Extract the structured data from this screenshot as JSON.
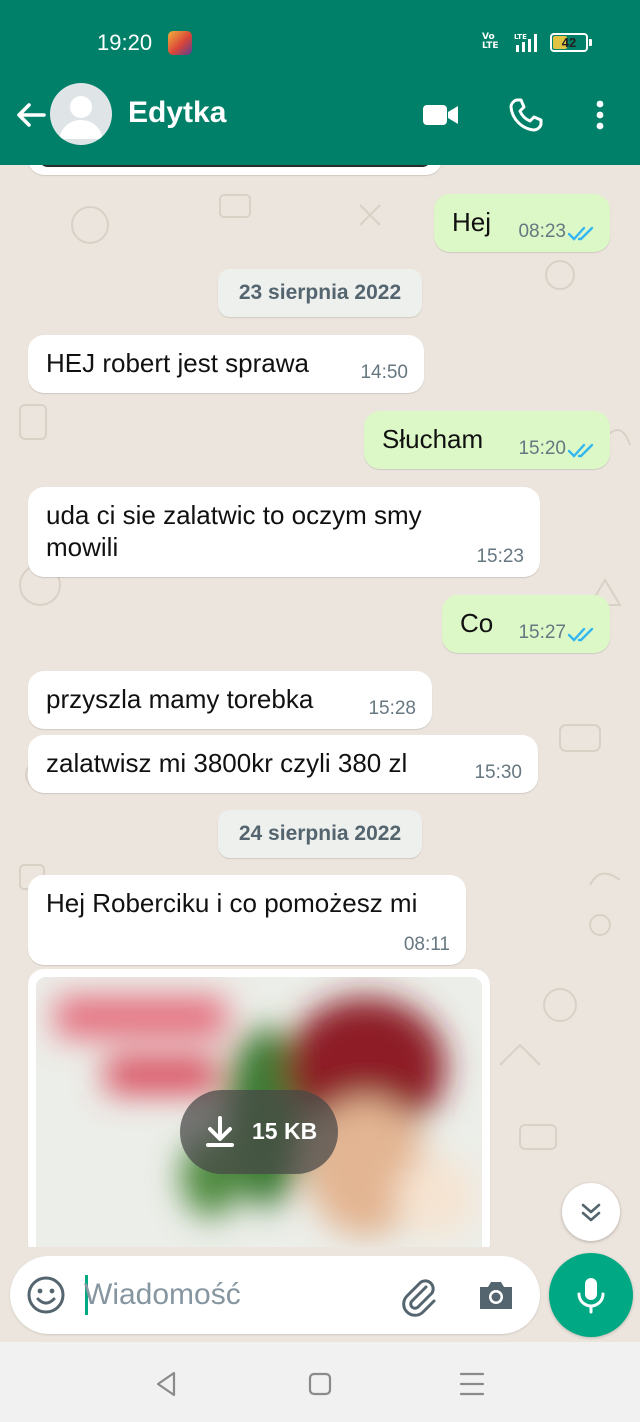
{
  "status_bar": {
    "time": "19:20",
    "volte": "Vo\nLTE",
    "lte": "LTE",
    "battery_percent": "42",
    "battery_level": 0.42
  },
  "header": {
    "contact_name": "Edytka",
    "icons": [
      "arrow-left-icon",
      "avatar",
      "video-call-icon",
      "phone-icon",
      "more-vert-icon"
    ],
    "accent_color": "#008069"
  },
  "messages": [
    {
      "dir": "out",
      "text": "Hej",
      "time": "08:23",
      "read": true
    },
    {
      "date": "23 sierpnia 2022"
    },
    {
      "dir": "in",
      "text": "HEJ robert jest sprawa",
      "time": "14:50"
    },
    {
      "dir": "out",
      "text": "Słucham",
      "time": "15:20",
      "read": true
    },
    {
      "dir": "in",
      "text": "uda ci sie zalatwic to oczym smy mowili",
      "time": "15:23"
    },
    {
      "dir": "out",
      "text": "Co",
      "time": "15:27",
      "read": true
    },
    {
      "dir": "in",
      "text": "przyszla mamy torebka",
      "time": "15:28"
    },
    {
      "dir": "in",
      "text": "zalatwisz mi 3800kr czyli 380 zl",
      "time": "15:30"
    },
    {
      "date": "24 sierpnia 2022"
    },
    {
      "dir": "in",
      "text": "Hej Roberciku i co pomożesz mi",
      "time": "08:11"
    }
  ],
  "media_message": {
    "download_size": "15 KB",
    "icon": "download-icon"
  },
  "composer": {
    "placeholder": "Wiadomość",
    "icons": [
      "emoji-icon",
      "attach-icon",
      "camera-icon",
      "mic-icon"
    ]
  },
  "colors": {
    "header": "#008069",
    "outgoing_bubble": "#dcf8c6",
    "incoming_bubble": "#ffffff",
    "read_ticks": "#34b7f1",
    "mic_button": "#00a884"
  }
}
